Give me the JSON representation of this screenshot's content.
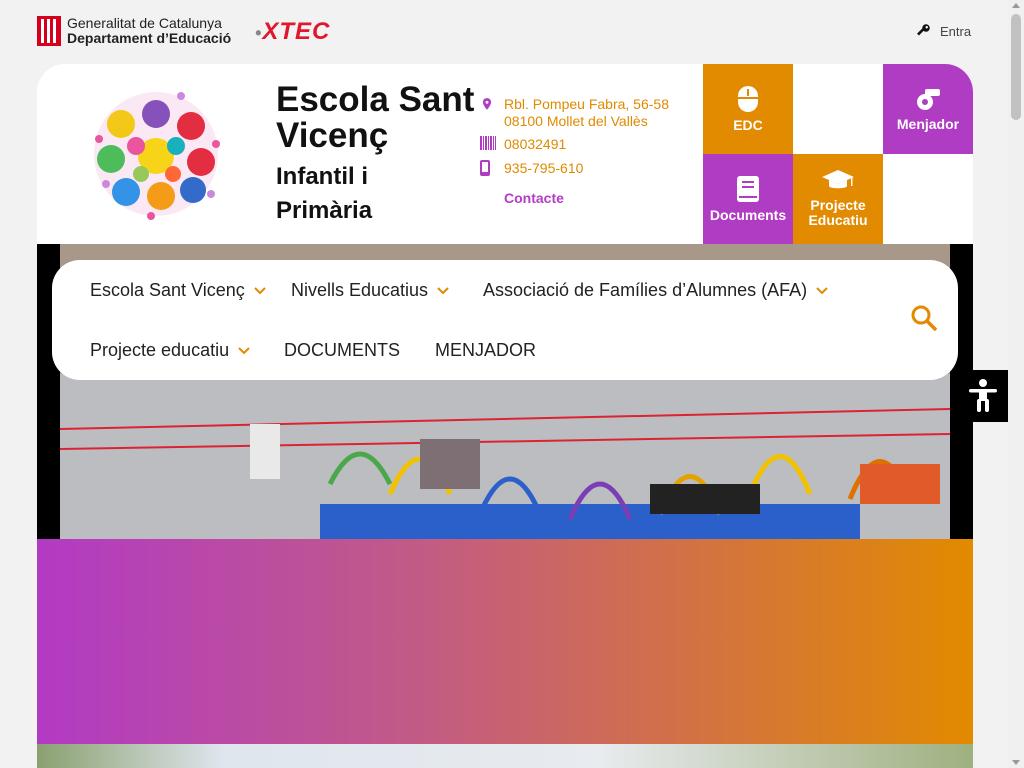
{
  "topbar": {
    "gencat_line1": "Generalitat de Catalunya",
    "gencat_line2": "Departament d’Educació",
    "xtec_label": "XTEC",
    "login_label": "Entra"
  },
  "header": {
    "school_name_line1": "Escola Sant",
    "school_name_line2": "Vicenç",
    "school_sub_line1": "Infantil i",
    "school_sub_line2": "Primària",
    "address_line1": "Rbl. Pompeu Fabra, 56-58",
    "address_line2": "08100 Mollet del Vallès",
    "code": "08032491",
    "phone": "935-795-610",
    "contact_label": "Contacte"
  },
  "tiles": {
    "edc": "EDC",
    "menjador": "Menjador",
    "documents": "Documents",
    "projecte_line1": "Projecte",
    "projecte_line2": "Educatiu"
  },
  "nav": {
    "items": [
      "Escola Sant Vicenç",
      "Nivells Educatius",
      "Associació de Famílies d’Alumnes (AFA)",
      "Projecte educatiu",
      "DOCUMENTS",
      "MENJADOR"
    ]
  },
  "colors": {
    "orange": "#e28a00",
    "purple": "#b13cc4",
    "xtec_red": "#e0182e"
  },
  "icons": [
    "key-icon",
    "location-pin-icon",
    "barcode-icon",
    "phone-icon",
    "mouse-icon",
    "whistle-icon",
    "book-icon",
    "graduation-cap-icon",
    "search-icon",
    "accessibility-icon",
    "chevron-down-icon"
  ]
}
